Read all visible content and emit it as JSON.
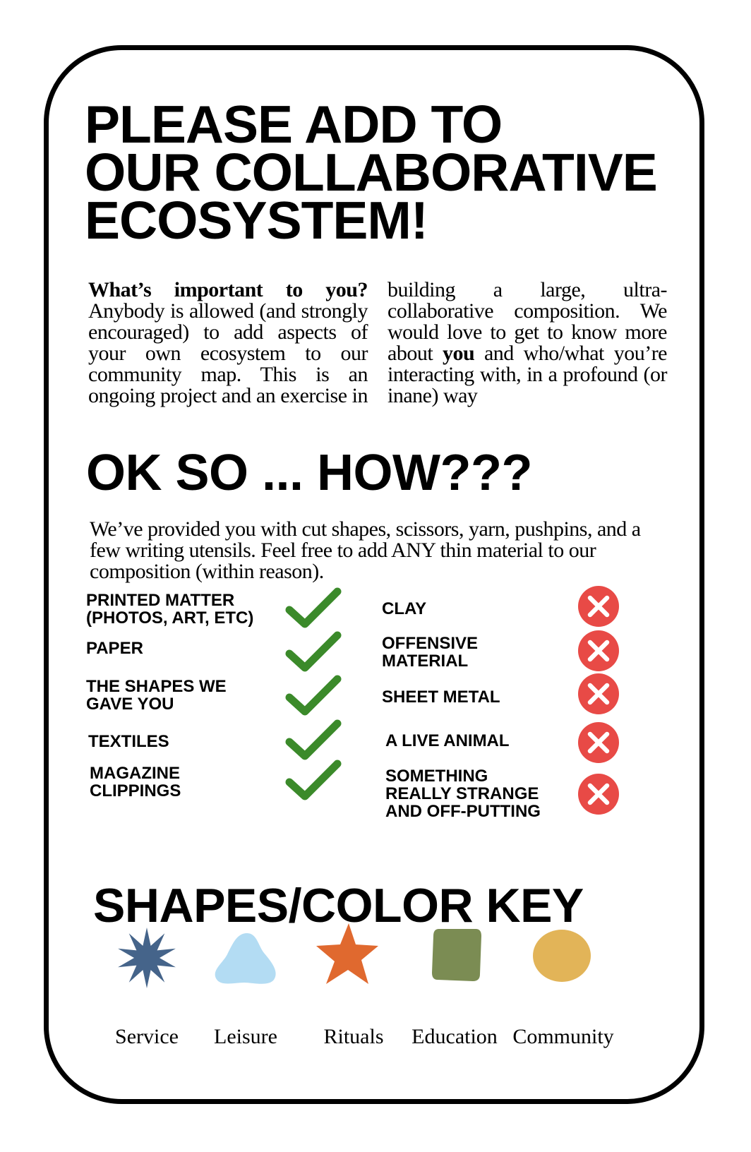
{
  "headline": [
    "PLEASE ADD TO",
    "OUR COLLABORATIVE",
    "ECOSYSTEM!"
  ],
  "intro": {
    "lead": "What’s important to you?",
    "text": " Anybody is allowed (and strongly encouraged) to add aspects of your own ecosystem to our community map. This is an ongoing project and an exercise in building a large, ultra-collaborative composition. We would love to get to know more about ",
    "emphasis": "you",
    "tail": " and who/what you’re interacting with, in a profound (or inane) way"
  },
  "subhead": "OK SO ... HOW???",
  "howto": "We’ve provided you with cut shapes, scissors, yarn, pushpins, and a few writing utensils. Feel free to add ANY thin material to our composition (within reason).",
  "allowed": [
    [
      "PRINTED MATTER",
      "(PHOTOS, ART, ETC)"
    ],
    [
      "PAPER"
    ],
    [
      "THE SHAPES WE",
      "GAVE YOU"
    ],
    [
      "TEXTILES"
    ],
    [
      "MAGAZINE",
      "CLIPPINGS"
    ]
  ],
  "not_allowed": [
    [
      "CLAY"
    ],
    [
      "OFFENSIVE",
      "MATERIAL"
    ],
    [
      "SHEET METAL"
    ],
    [
      "A LIVE ANIMAL"
    ],
    [
      "SOMETHING",
      "REALLY STRANGE",
      "AND OFF-PUTTING"
    ]
  ],
  "key_title": "SHAPES/COLOR KEY",
  "key": [
    {
      "label": "Service",
      "shape": "starburst-icon",
      "color": "#45648a"
    },
    {
      "label": "Leisure",
      "shape": "blob-icon",
      "color": "#b3dcf3"
    },
    {
      "label": "Rituals",
      "shape": "star-icon",
      "color": "#e0692f"
    },
    {
      "label": "Education",
      "shape": "rounded-square-icon",
      "color": "#7b8c53"
    },
    {
      "label": "Community",
      "shape": "circle-icon",
      "color": "#e2b458"
    }
  ],
  "colors": {
    "check": "#3b8a2a",
    "x": "#e84a46",
    "border": "#000000"
  }
}
